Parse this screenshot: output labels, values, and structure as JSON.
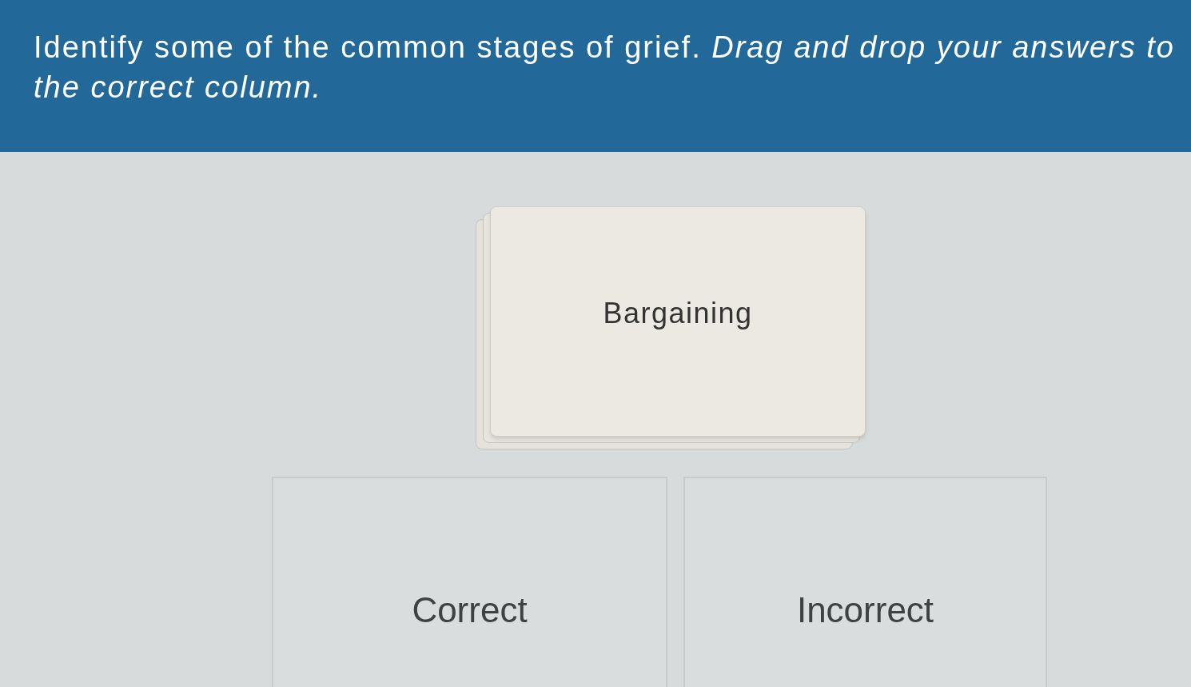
{
  "prompt": "Identify some of the common stages of grief. *Drag and drop your answers to the correct column.*",
  "card_stack": {
    "top_card": "Bargaining"
  },
  "columns": [
    {
      "label": "Correct"
    },
    {
      "label": "Incorrect"
    }
  ]
}
